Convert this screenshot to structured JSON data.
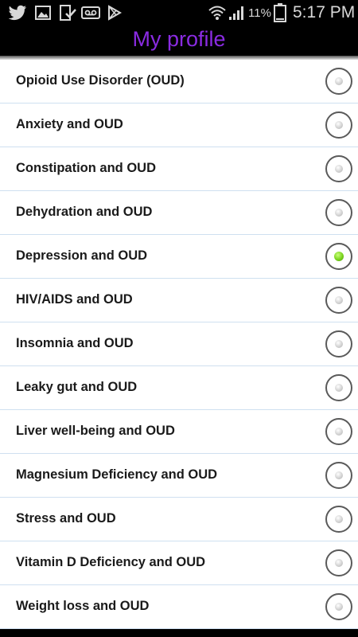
{
  "status_bar": {
    "icons": [
      "twitter-icon",
      "image-icon",
      "download-done-icon",
      "voicemail-icon",
      "play-store-icon",
      "wifi-icon",
      "signal-icon",
      "battery-icon"
    ],
    "battery_percent": "11%",
    "time": "5:17 PM"
  },
  "header": {
    "title": "My profile",
    "title_color": "#8a2be2"
  },
  "list": {
    "items": [
      {
        "label": "Opioid Use Disorder (OUD)",
        "selected": false
      },
      {
        "label": "Anxiety and OUD",
        "selected": false
      },
      {
        "label": "Constipation and OUD",
        "selected": false
      },
      {
        "label": "Dehydration and OUD",
        "selected": false
      },
      {
        "label": "Depression and OUD",
        "selected": true
      },
      {
        "label": "HIV/AIDS and OUD",
        "selected": false
      },
      {
        "label": "Insomnia and OUD",
        "selected": false
      },
      {
        "label": "Leaky gut and OUD",
        "selected": false
      },
      {
        "label": "Liver well-being and OUD",
        "selected": false
      },
      {
        "label": "Magnesium Deficiency and OUD",
        "selected": false
      },
      {
        "label": "Stress and OUD",
        "selected": false
      },
      {
        "label": "Vitamin D Deficiency and OUD",
        "selected": false
      },
      {
        "label": "Weight loss and OUD",
        "selected": false
      }
    ],
    "selected_color": "#7ad31e"
  }
}
